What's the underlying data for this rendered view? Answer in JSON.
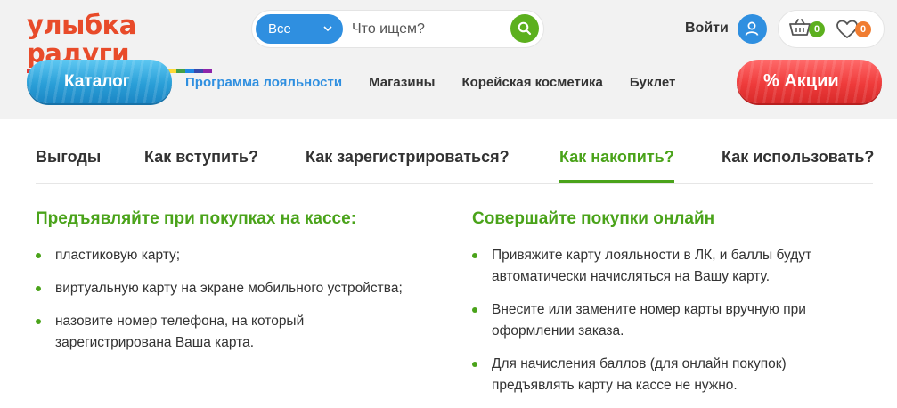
{
  "brand": {
    "logo_text": "улыбка радуги",
    "stripe_colors": [
      "#e53935",
      "#fb8c00",
      "#fdd835",
      "#43a047",
      "#1e88e5",
      "#3949ab",
      "#8e24aa"
    ]
  },
  "search": {
    "category": "Все",
    "placeholder": "Что ищем?"
  },
  "account": {
    "login_label": "Войти",
    "cart_count": "0",
    "favorites_count": "0"
  },
  "nav": {
    "catalog_label": "Каталог",
    "items": [
      {
        "label": "Программа лояльности",
        "active": true
      },
      {
        "label": "Магазины",
        "active": false
      },
      {
        "label": "Корейская косметика",
        "active": false
      },
      {
        "label": "Буклет",
        "active": false
      }
    ],
    "sale_label": "% Акции"
  },
  "tabs": [
    {
      "label": "Выгоды",
      "active": false
    },
    {
      "label": "Как вступить?",
      "active": false
    },
    {
      "label": "Как зарегистрироваться?",
      "active": false
    },
    {
      "label": "Как накопить?",
      "active": true
    },
    {
      "label": "Как использовать?",
      "active": false
    }
  ],
  "content": {
    "left": {
      "title": "Предъявляйте при покупках на кассе:",
      "items": [
        "пластиковую карту;",
        "виртуальную карту на экране мобильного устройства;",
        "назовите номер телефона, на который зарегистрирована Ваша карта."
      ]
    },
    "right": {
      "title": "Совершайте покупки онлайн",
      "items": [
        "Привяжите карту лояльности в ЛК, и баллы будут автоматически начисляться на Вашу карту.",
        "Внесите или замените номер карты вручную при оформлении заказа.",
        "Для начисления баллов (для онлайн покупок) предъявлять карту на кассе не нужно."
      ]
    }
  },
  "colors": {
    "accent_green": "#4aa31a",
    "accent_blue": "#2f8fe0",
    "sale_red": "#ef3b3b",
    "logo_orange": "#e84b2a"
  }
}
